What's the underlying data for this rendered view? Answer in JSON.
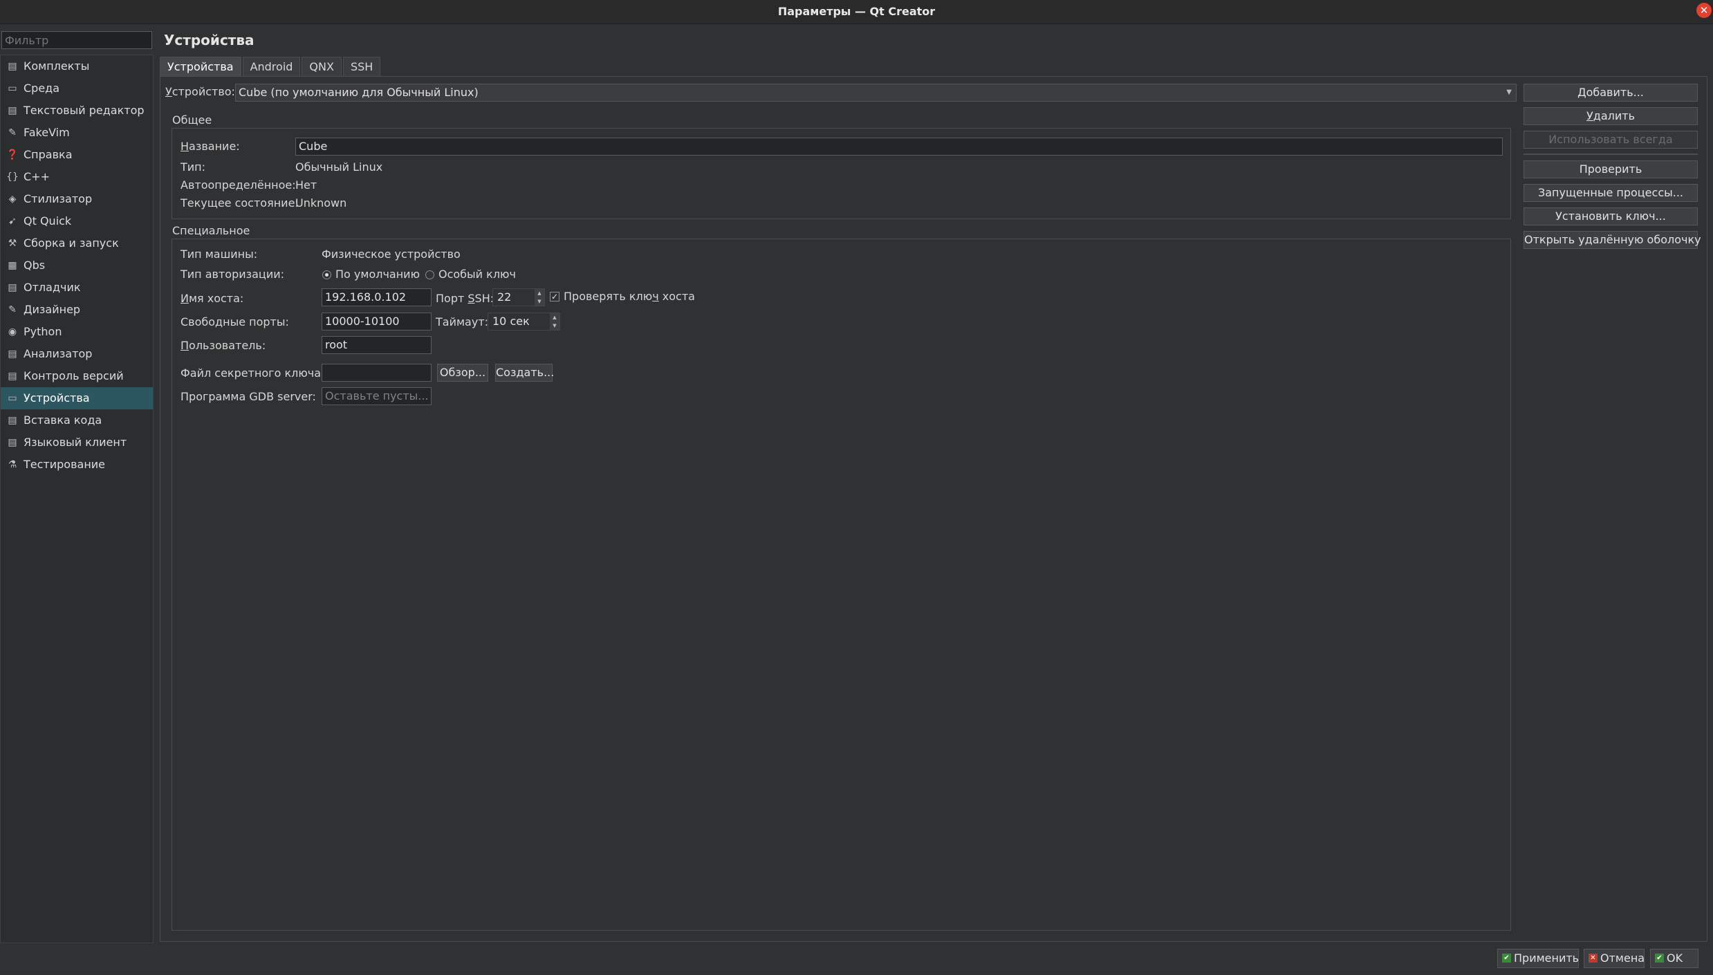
{
  "window": {
    "title": "Параметры — Qt Creator",
    "close_glyph": "✕"
  },
  "filter": {
    "placeholder": "Фильтр"
  },
  "sidebar": {
    "items": [
      {
        "label": "Комплекты",
        "icon": "kits-icon",
        "glyph": "▤"
      },
      {
        "label": "Среда",
        "icon": "monitor-icon",
        "glyph": "▭"
      },
      {
        "label": "Текстовый редактор",
        "icon": "text-editor-icon",
        "glyph": "▤"
      },
      {
        "label": "FakeVim",
        "icon": "fakevim-icon",
        "glyph": "✎"
      },
      {
        "label": "Справка",
        "icon": "help-icon",
        "glyph": "❓"
      },
      {
        "label": "C++",
        "icon": "braces-icon",
        "glyph": "{}"
      },
      {
        "label": "Стилизатор",
        "icon": "beautifier-icon",
        "glyph": "◈"
      },
      {
        "label": "Qt Quick",
        "icon": "qtquick-icon",
        "glyph": "➹"
      },
      {
        "label": "Сборка и запуск",
        "icon": "hammer-icon",
        "glyph": "⚒"
      },
      {
        "label": "Qbs",
        "icon": "qbs-icon",
        "glyph": "▦"
      },
      {
        "label": "Отладчик",
        "icon": "debugger-icon",
        "glyph": "▤"
      },
      {
        "label": "Дизайнер",
        "icon": "designer-pen-icon",
        "glyph": "✎"
      },
      {
        "label": "Python",
        "icon": "python-icon",
        "glyph": "◉"
      },
      {
        "label": "Анализатор",
        "icon": "analyzer-icon",
        "glyph": "▤"
      },
      {
        "label": "Контроль версий",
        "icon": "version-control-icon",
        "glyph": "▤"
      },
      {
        "label": "Устройства",
        "icon": "devices-icon",
        "glyph": "▭"
      },
      {
        "label": "Вставка кода",
        "icon": "code-paste-icon",
        "glyph": "▤"
      },
      {
        "label": "Языковый клиент",
        "icon": "language-client-icon",
        "glyph": "▤"
      },
      {
        "label": "Тестирование",
        "icon": "testing-icon",
        "glyph": "⚗"
      }
    ],
    "selected_index": 15
  },
  "page": {
    "title": "Устройства",
    "tabs": [
      "Устройства",
      "Android",
      "QNX",
      "SSH"
    ]
  },
  "device": {
    "label": "Устройство:",
    "label_u": "У",
    "label_rest": "стройство:",
    "selected": "Cube (по умолчанию для Обычный Linux)"
  },
  "general": {
    "title": "Общее",
    "name_label_u": "Н",
    "name_label_rest": "азвание:",
    "name_value": "Cube",
    "type_label": "Тип:",
    "type_value": "Обычный Linux",
    "autodetected_label": "Автоопределённое:",
    "autodetected_value": "Нет",
    "state_label": "Текущее состояние:",
    "state_value": "Unknown"
  },
  "specific": {
    "title": "Специальное",
    "machine_type_label": "Тип машины:",
    "machine_type_value": "Физическое устройство",
    "auth_type_label": "Тип авторизации:",
    "auth_default": "По умолчанию",
    "auth_key": "Особый ключ",
    "host_label_u": "И",
    "host_label_rest": "мя хоста:",
    "host_value": "192.168.0.102",
    "ssh_port_label_a": "Порт ",
    "ssh_port_label_u": "S",
    "ssh_port_label_b": "SH:",
    "ssh_port_value": "22",
    "check_host_key_a": "Проверять клю",
    "check_host_key_u": "ч",
    "check_host_key_b": " хоста",
    "free_ports_label": "Свободные порты:",
    "free_ports_value": "10000-10100",
    "timeout_label": "Таймаут:",
    "timeout_value": "10 сек",
    "user_label_u": "П",
    "user_label_rest": "ользователь:",
    "user_value": "root",
    "key_file_label": "Файл секретного ключа:",
    "key_file_value": "",
    "browse_button": "Обзор...",
    "create_button": "Создать...",
    "gdb_label": "Программа GDB server:",
    "gdb_placeholder": "Оставьте пусты..."
  },
  "actions": {
    "add_a": "",
    "add_u": "Д",
    "add_b": "обавить...",
    "remove_u": "У",
    "remove_b": "далить",
    "use_always": "Использовать всегда",
    "test": "Проверить",
    "processes": "Запущенные процессы...",
    "install_key": "Установить ключ...",
    "open_shell": "Открыть удалённую оболочку"
  },
  "footer": {
    "apply": "Применить",
    "cancel": "Отмена",
    "ok": "OK"
  },
  "colors": {
    "selection": "#2c5660",
    "apply_icon": "#3a8a3a",
    "cancel_icon": "#c0392b",
    "ok_icon": "#3a8a3a"
  }
}
